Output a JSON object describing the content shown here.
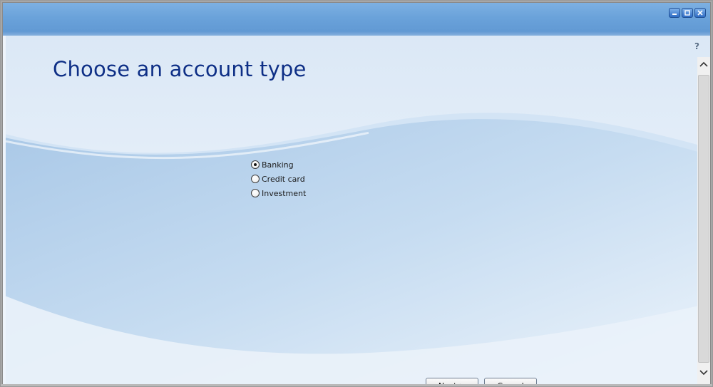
{
  "window": {
    "title": "",
    "controls": [
      "minimize-icon",
      "maximize-icon",
      "close-icon"
    ]
  },
  "help": {
    "label": "?"
  },
  "page": {
    "title": "Choose an account type"
  },
  "account_types": {
    "options": [
      {
        "label": "Banking",
        "checked": true
      },
      {
        "label": "Credit card",
        "checked": false
      },
      {
        "label": "Investment",
        "checked": false
      }
    ]
  },
  "buttons": {
    "next": "Next >",
    "cancel": "Cancel"
  },
  "colors": {
    "title": "#0e2f86",
    "titlebar": "#6aa2da",
    "background": "#eef4fb"
  }
}
